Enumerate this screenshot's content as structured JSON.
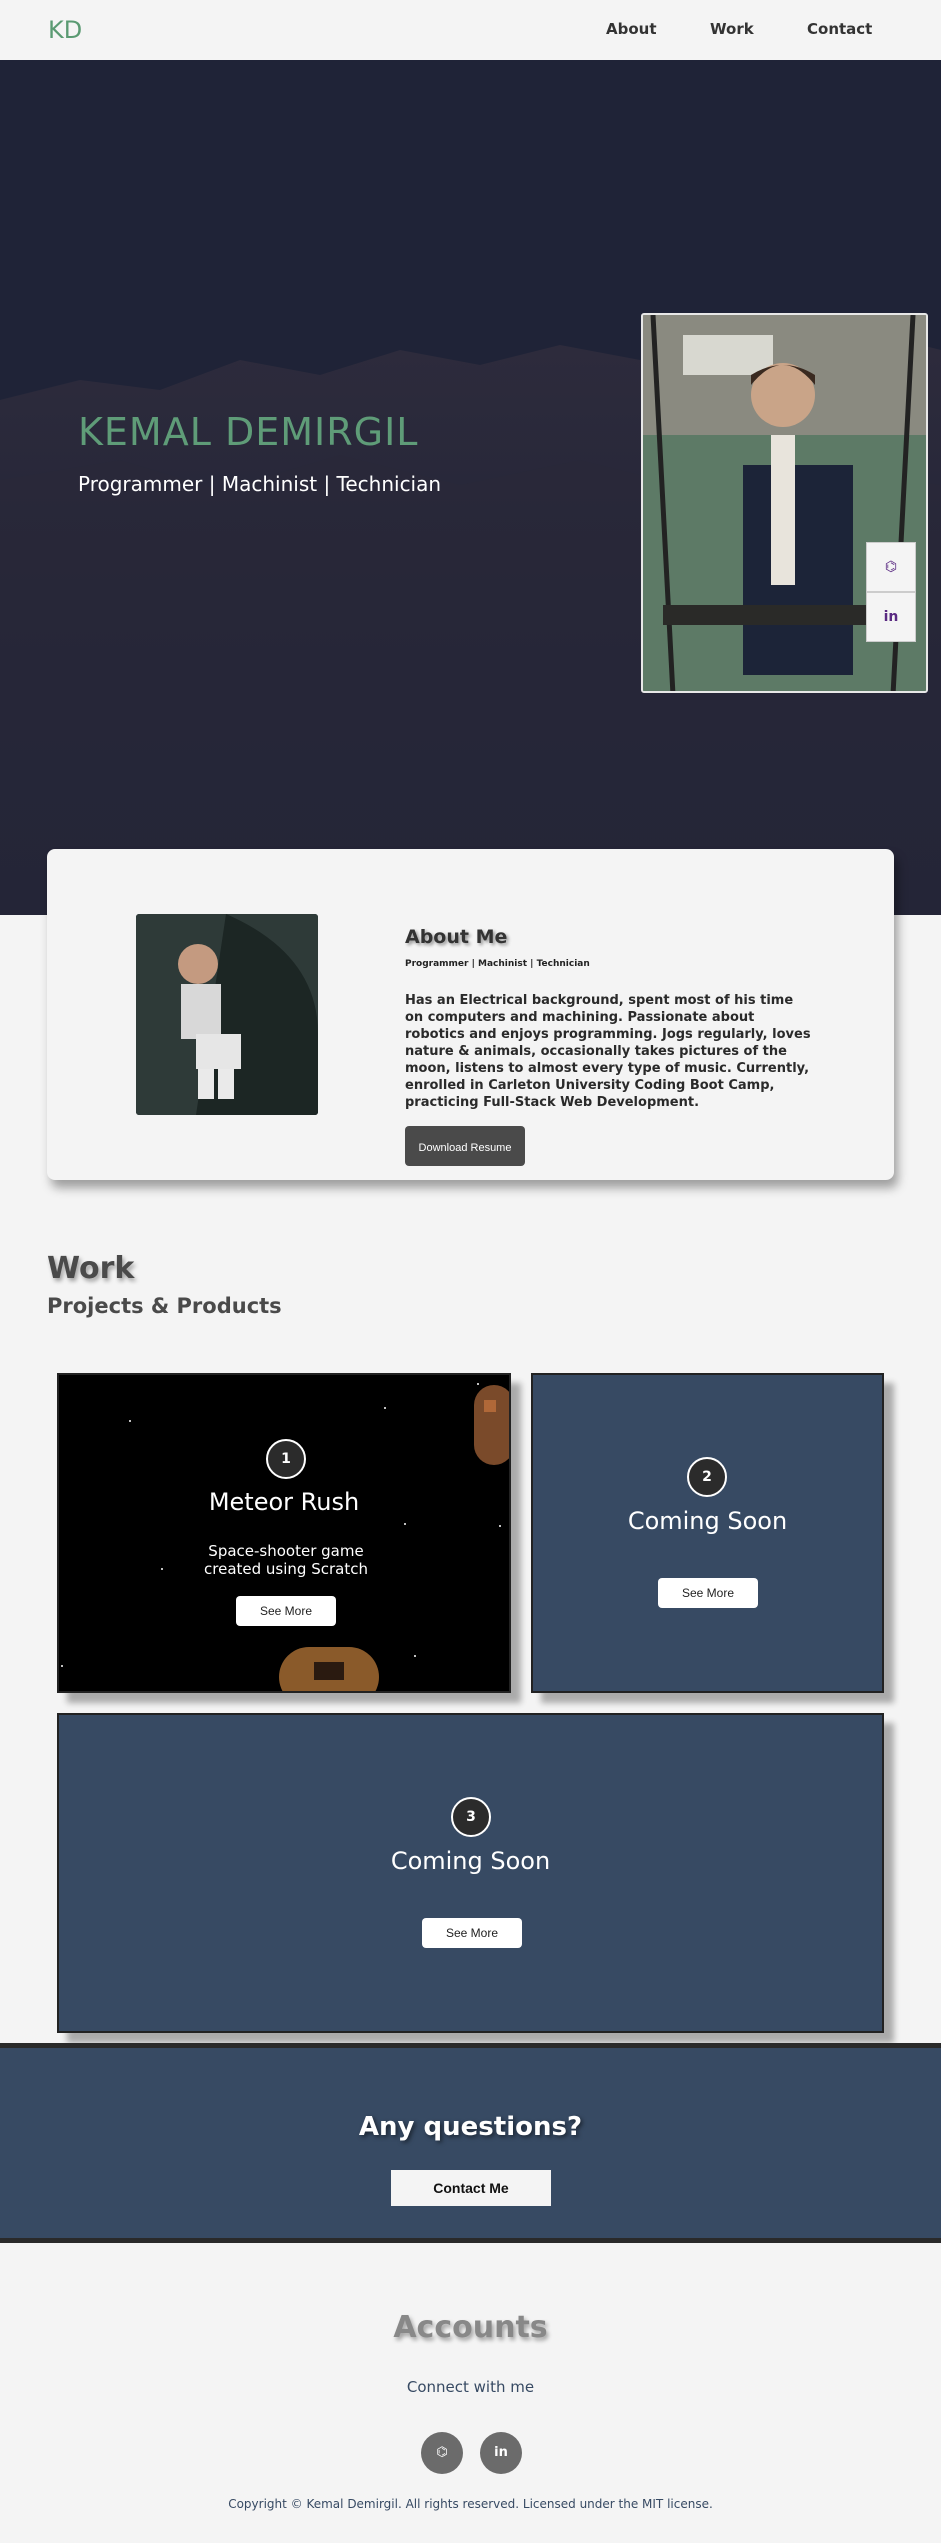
{
  "nav": {
    "logo": "KD",
    "links": [
      "About",
      "Work",
      "Contact"
    ]
  },
  "hero": {
    "name": "KEMAL DEMIRGIL",
    "subtitle": "Programmer | Machinist | Technician",
    "social_icons": [
      "github-icon",
      "linkedin-icon"
    ],
    "social_labels": [
      "⌬",
      "in"
    ]
  },
  "about": {
    "title": "About Me",
    "tagline": "Programmer | Machinist | Technician",
    "text": "Has an Electrical background, spent most of his time on computers and machining. Passionate about robotics and enjoys programming. Jogs regularly, loves nature & animals, occasionally takes pictures of the moon, listens to almost every type of music. Currently, enrolled in Carleton University Coding Boot Camp, practicing Full-Stack Web Development.",
    "button": "Download Resume"
  },
  "work": {
    "title": "Work",
    "subtitle": "Projects & Products",
    "projects": [
      {
        "number": "1",
        "title": "Meteor Rush",
        "description": "Space-shooter game created using Scratch",
        "button": "See More"
      },
      {
        "number": "2",
        "title": "Coming Soon",
        "description": "",
        "button": "See More"
      },
      {
        "number": "3",
        "title": "Coming Soon",
        "description": "",
        "button": "See More"
      }
    ]
  },
  "contact": {
    "question": "Any questions?",
    "button": "Contact Me"
  },
  "accounts": {
    "title": "Accounts",
    "subtitle": "Connect with me",
    "icons": [
      "github-icon",
      "linkedin-icon"
    ],
    "icon_labels": [
      "⌬",
      "in"
    ],
    "copyright": "Copyright © Kemal Demirgil. All rights reserved. Licensed under the MIT license."
  },
  "colors": {
    "accent_green": "#5f9c78",
    "navy": "#374a63",
    "hero_bg": "#1f2337",
    "page_bg": "#f4f4f4"
  }
}
